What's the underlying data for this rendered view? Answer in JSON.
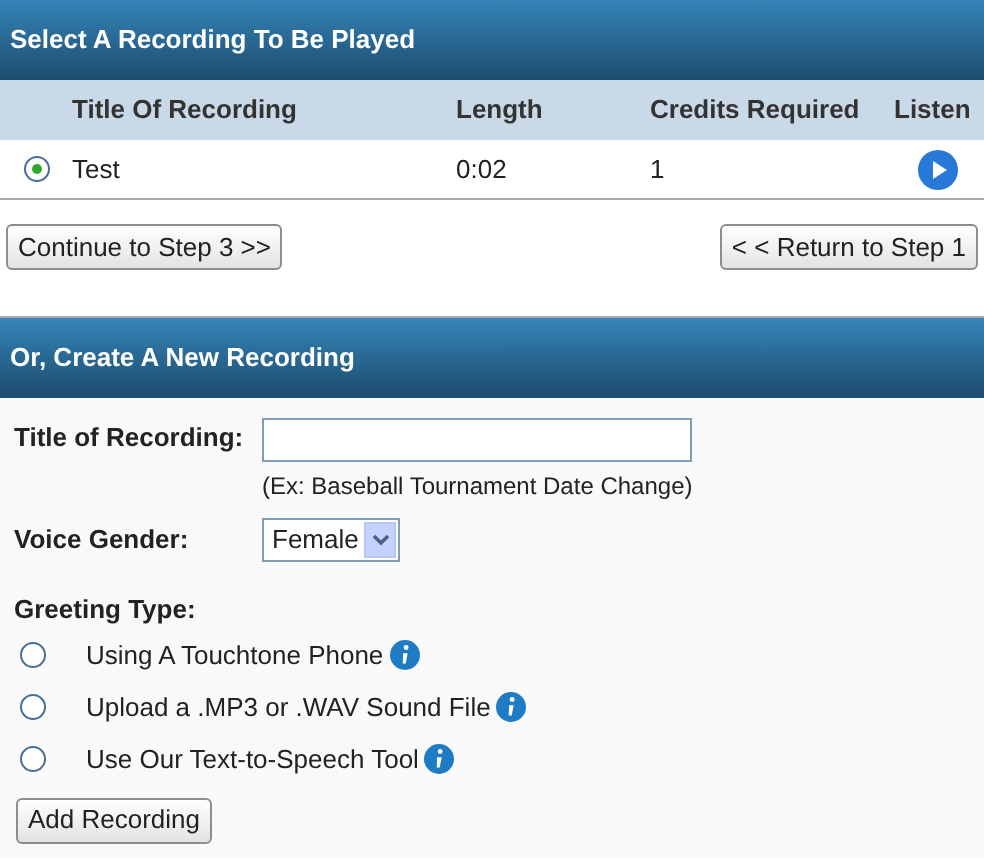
{
  "recordings": {
    "title": "Select A Recording To Be Played",
    "columns": [
      "Title Of Recording",
      "Length",
      "Credits Required",
      "Listen"
    ],
    "rows": [
      {
        "title": "Test",
        "length": "0:02",
        "credits": "1",
        "selected": true
      }
    ],
    "buttons": {
      "continue": "Continue to Step 3 >>",
      "return": "< < Return to Step 1"
    }
  },
  "new_recording": {
    "title": "Or, Create A New Recording",
    "title_label": "Title of Recording:",
    "title_hint": "(Ex: Baseball Tournament Date Change)",
    "gender_label": "Voice Gender:",
    "gender_value": "Female",
    "greeting_label": "Greeting Type:",
    "greeting_options": [
      {
        "label": "Using A Touchtone Phone",
        "selected": false
      },
      {
        "label": "Upload a .MP3 or .WAV Sound File",
        "selected": false
      },
      {
        "label": "Use Our Text-to-Speech Tool",
        "selected": false
      }
    ],
    "add_button": "Add Recording"
  }
}
